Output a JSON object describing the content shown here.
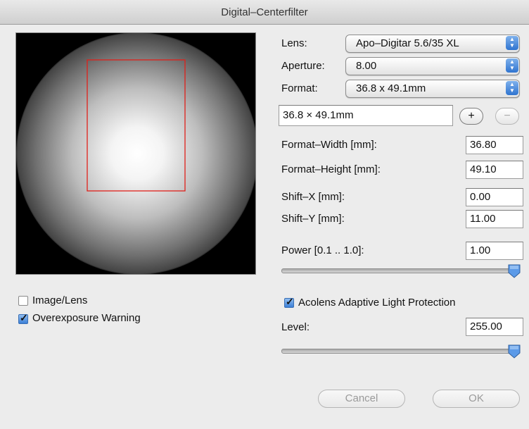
{
  "window": {
    "title": "Digital–Centerfilter"
  },
  "lens": {
    "label": "Lens:",
    "value": "Apo–Digitar 5.6/35 XL"
  },
  "aperture": {
    "label": "Aperture:",
    "value": "8.00"
  },
  "format": {
    "label": "Format:",
    "value": "36.8 x 49.1mm",
    "name_value": "36.8 × 49.1mm",
    "add_label": "+",
    "remove_label": "−"
  },
  "format_width": {
    "label": "Format–Width [mm]:",
    "value": "36.80"
  },
  "format_height": {
    "label": "Format–Height [mm]:",
    "value": "49.10"
  },
  "shift_x": {
    "label": "Shift–X [mm]:",
    "value": "0.00"
  },
  "shift_y": {
    "label": "Shift–Y [mm]:",
    "value": "11.00"
  },
  "power": {
    "label": "Power  [0.1 .. 1.0]:",
    "value": "1.00",
    "slider_fraction": 1.0
  },
  "options": {
    "image_lens": {
      "label": "Image/Lens",
      "checked": false
    },
    "overexposure": {
      "label": "Overexposure Warning",
      "checked": true
    }
  },
  "alp": {
    "label": "Acolens Adaptive Light Protection",
    "checked": true
  },
  "level": {
    "label": "Level:",
    "value": "255.00",
    "slider_fraction": 1.0
  },
  "buttons": {
    "cancel": "Cancel",
    "ok": "OK"
  },
  "colors": {
    "crop_rect": "#e0201a",
    "accent": "#3b7fd6"
  },
  "icons": {
    "popup": "up-down-arrows-icon",
    "slider_thumb": "slider-thumb-icon"
  }
}
